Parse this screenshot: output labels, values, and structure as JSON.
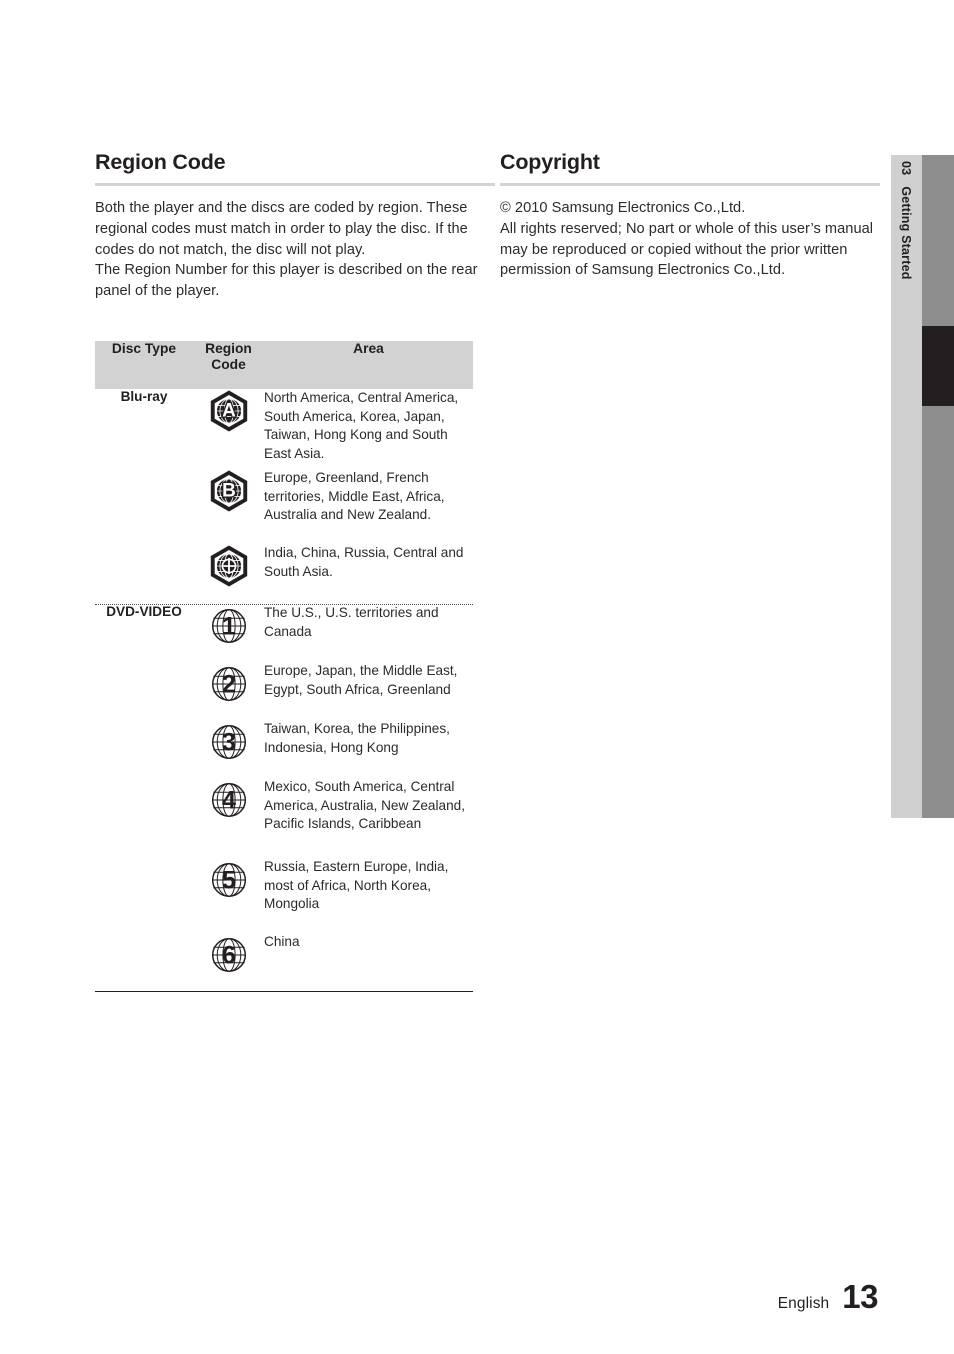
{
  "sidetab": {
    "number": "03",
    "label": "Getting Started"
  },
  "left_column": {
    "title": "Region Code",
    "paragraphs": [
      "Both the player and the discs are coded by region. These regional codes must match in order to play the disc. If the codes do not match, the disc will not play.",
      "The Region Number for this player is described on the rear panel of the player."
    ]
  },
  "right_column": {
    "title": "Copyright",
    "paragraphs": [
      "© 2010 Samsung Electronics Co.,Ltd.",
      "All rights reserved; No part or whole of this user’s manual may be reproduced or copied without the prior written permission of Samsung Electronics Co.,Ltd."
    ]
  },
  "table": {
    "headers": [
      "Disc Type",
      "Region Code",
      "Area"
    ],
    "groups": [
      {
        "disc_type": "Blu-ray",
        "icon_style": "hex-globe",
        "rows": [
          {
            "code": "A",
            "area": "North America, Central America, South America, Korea, Japan, Taiwan, Hong Kong and South East Asia."
          },
          {
            "code": "B",
            "area": "Europe, Greenland, French territories, Middle East, Africa, Australia and New Zealand."
          },
          {
            "code": "C",
            "area": "India, China, Russia, Central and South Asia."
          }
        ]
      },
      {
        "disc_type": "DVD-VIDEO",
        "icon_style": "globe-number",
        "rows": [
          {
            "code": "1",
            "area": "The U.S., U.S. territories and Canada"
          },
          {
            "code": "2",
            "area": "Europe, Japan, the Middle East, Egypt, South Africa, Greenland"
          },
          {
            "code": "3",
            "area": "Taiwan, Korea, the Philippines, Indonesia, Hong Kong"
          },
          {
            "code": "4",
            "area": "Mexico, South America, Central America, Australia, New Zealand, Pacific Islands, Caribbean"
          },
          {
            "code": "5",
            "area": "Russia, Eastern Europe, India, most of Africa, North Korea, Mongolia"
          },
          {
            "code": "6",
            "area": "China"
          }
        ]
      }
    ]
  },
  "footer": {
    "language": "English",
    "page_number": "13"
  },
  "colors": {
    "ink": "#231f20",
    "rule": "#d2d2d2",
    "header_fill": "#d2d2d2",
    "sidetab_fill": "#d0d0d0",
    "sidebar_gray": "#8e8e8e",
    "sidebar_active": "#231f20"
  }
}
